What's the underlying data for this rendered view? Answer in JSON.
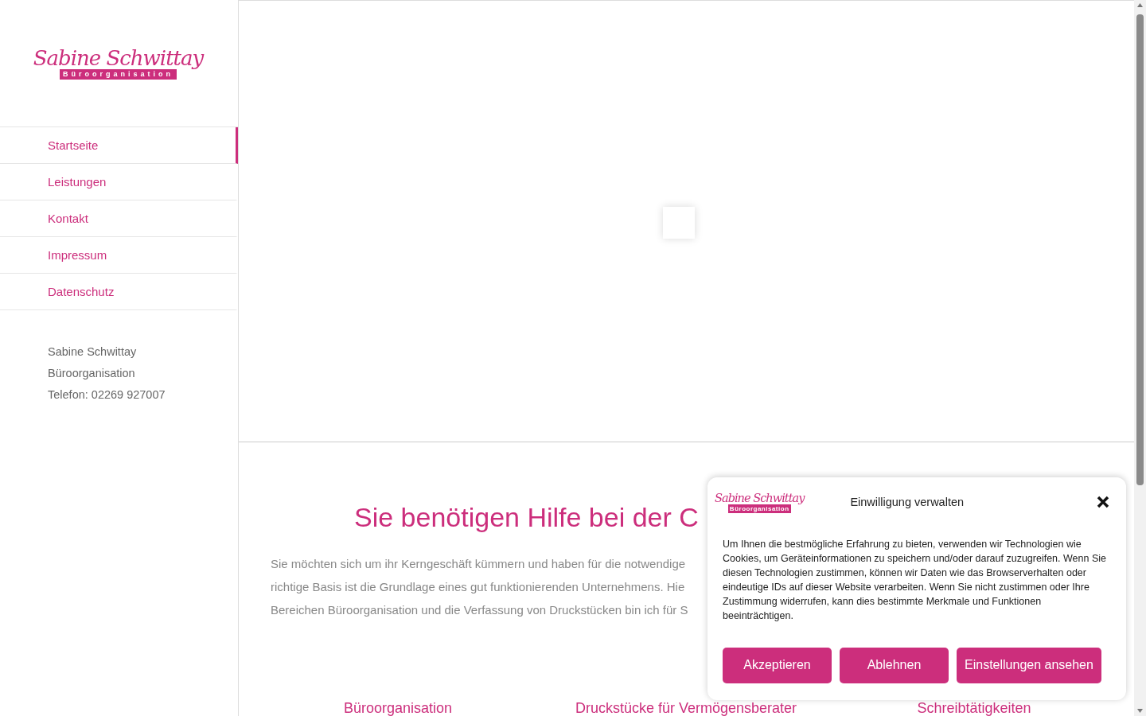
{
  "sidebar": {
    "logo": {
      "name": "Sabine Schwittay",
      "subtitle": "Büroorganisation"
    },
    "nav": [
      {
        "label": "Startseite",
        "selected": true
      },
      {
        "label": "Leistungen",
        "selected": false
      },
      {
        "label": "Kontakt",
        "selected": false
      },
      {
        "label": "Impressum",
        "selected": false
      },
      {
        "label": "Datenschutz",
        "selected": false
      }
    ],
    "contact": [
      "Sabine Schwittay",
      "Büroorganisation",
      "Telefon: 02269 927007"
    ]
  },
  "main": {
    "heading": "Sie benötigen Hilfe bei der C",
    "intro_lines": [
      "Sie möchten sich um ihr Kerngeschäft kümmern und haben für die notwendige",
      "richtige Basis ist die Grundlage eines gut funktionierenden Unternehmens. Hie",
      "Bereichen Büroorganisation und die Verfassung von Druckstücken bin ich für S"
    ],
    "services": [
      "Büroorganisation",
      "Druckstücke für Vermögensberater",
      "Schreibtätigkeiten"
    ]
  },
  "consent_dialog": {
    "logo": {
      "name": "Sabine Schwittay",
      "subtitle": "Büroorganisation"
    },
    "title": "Einwilligung verwalten",
    "text": "Um Ihnen die bestmögliche Erfahrung zu bieten, verwenden wir Technologien wie Cookies, um Geräteinformationen zu speichern und/oder darauf zuzugreifen. Wenn Sie diesen Technologien zustimmen, können wir Daten wie das Browserverhalten oder eindeutige IDs auf dieser Website verarbeiten. Wenn Sie nicht zustimmen oder Ihre Zustimmung widerrufen, kann dies bestimmte Merkmale und Funktionen beeinträchtigen.",
    "buttons": [
      "Akzeptieren",
      "Ablehnen",
      "Einstellungen ansehen"
    ]
  }
}
